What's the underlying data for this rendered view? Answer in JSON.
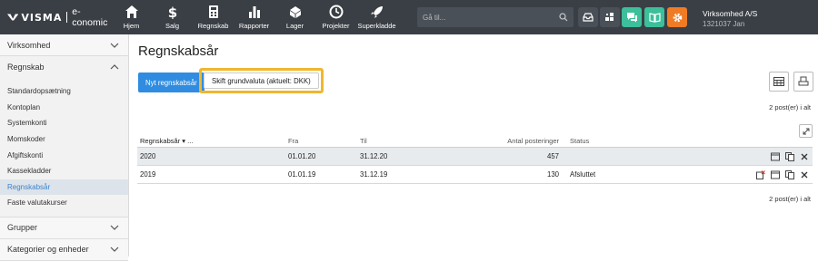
{
  "app": {
    "brand": "VISMA",
    "product": "e-conomic"
  },
  "nav": [
    {
      "label": "Hjem",
      "icon": "home-icon"
    },
    {
      "label": "Salg",
      "icon": "dollar-icon"
    },
    {
      "label": "Regnskab",
      "icon": "calculator-icon"
    },
    {
      "label": "Rapporter",
      "icon": "bar-chart-icon"
    },
    {
      "label": "Lager",
      "icon": "box-icon"
    },
    {
      "label": "Projekter",
      "icon": "clock-icon"
    },
    {
      "label": "Superkladde",
      "icon": "rocket-icon"
    }
  ],
  "search": {
    "placeholder": "Gå til..."
  },
  "toolbar_colors": {
    "chat": "#3cbf9b",
    "book": "#3cbf9b",
    "settings": "#ef7c25"
  },
  "company": {
    "name": "Virksomhed A/S",
    "user": "1321037 Jan"
  },
  "sidebar": {
    "sections": [
      {
        "label": "Virksomhed"
      },
      {
        "label": "Regnskab"
      },
      {
        "label": "Grupper"
      },
      {
        "label": "Kategorier og enheder"
      }
    ],
    "items": [
      {
        "label": "Standardopsætning"
      },
      {
        "label": "Kontoplan"
      },
      {
        "label": "Systemkonti"
      },
      {
        "label": "Momskoder"
      },
      {
        "label": "Afgiftskonti"
      },
      {
        "label": "Kassekladder"
      },
      {
        "label": "Regnskabsår"
      },
      {
        "label": "Faste valutakurser"
      }
    ]
  },
  "main": {
    "title": "Regnskabsår",
    "new_button": "Nyt regnskabsår",
    "switch_button": "Skift grundvaluta (aktuelt: DKK)",
    "count_top": "2 post(er) i alt",
    "count_bottom": "2 post(er) i alt"
  },
  "table": {
    "headers": {
      "year": "Regnskabsår",
      "sort": "▾ ...",
      "from": "Fra",
      "to": "Til",
      "postings": "Antal posteringer",
      "status": "Status"
    },
    "rows": [
      {
        "year": "2020",
        "from": "01.01.20",
        "to": "31.12.20",
        "postings": "457",
        "status": ""
      },
      {
        "year": "2019",
        "from": "01.01.19",
        "to": "31.12.19",
        "postings": "130",
        "status": "Afsluttet"
      }
    ]
  }
}
